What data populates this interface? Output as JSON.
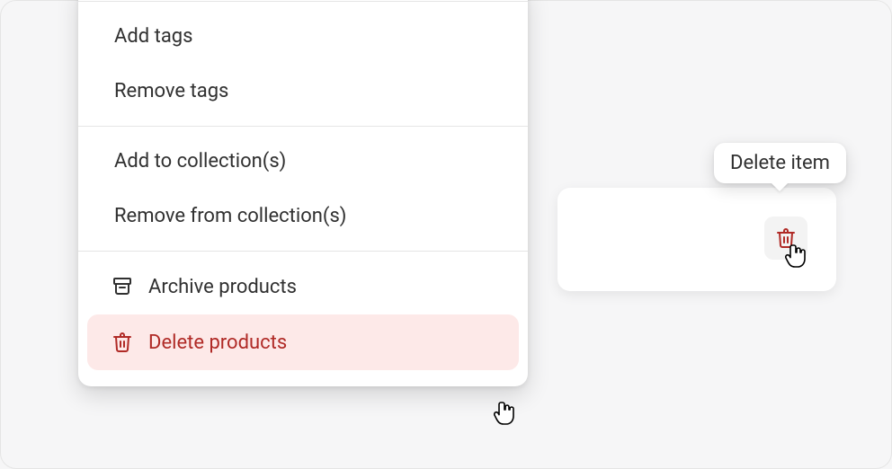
{
  "menu": {
    "groups": [
      {
        "items": [
          {
            "label": "Add tags"
          },
          {
            "label": "Remove tags"
          }
        ]
      },
      {
        "items": [
          {
            "label": "Add to collection(s)"
          },
          {
            "label": "Remove from collection(s)"
          }
        ]
      },
      {
        "items": [
          {
            "label": "Archive products",
            "icon": "archive-icon"
          },
          {
            "label": "Delete products",
            "icon": "trash-icon",
            "danger": true,
            "hovered": true
          }
        ]
      }
    ]
  },
  "tooltip": {
    "text": "Delete item"
  },
  "card_delete_button": {
    "icon": "trash-icon"
  },
  "colors": {
    "danger": "#b02a26",
    "danger_bg": "#fde9e8",
    "text": "#303030",
    "panel_bg": "#ffffff",
    "page_bg": "#f6f6f7"
  }
}
